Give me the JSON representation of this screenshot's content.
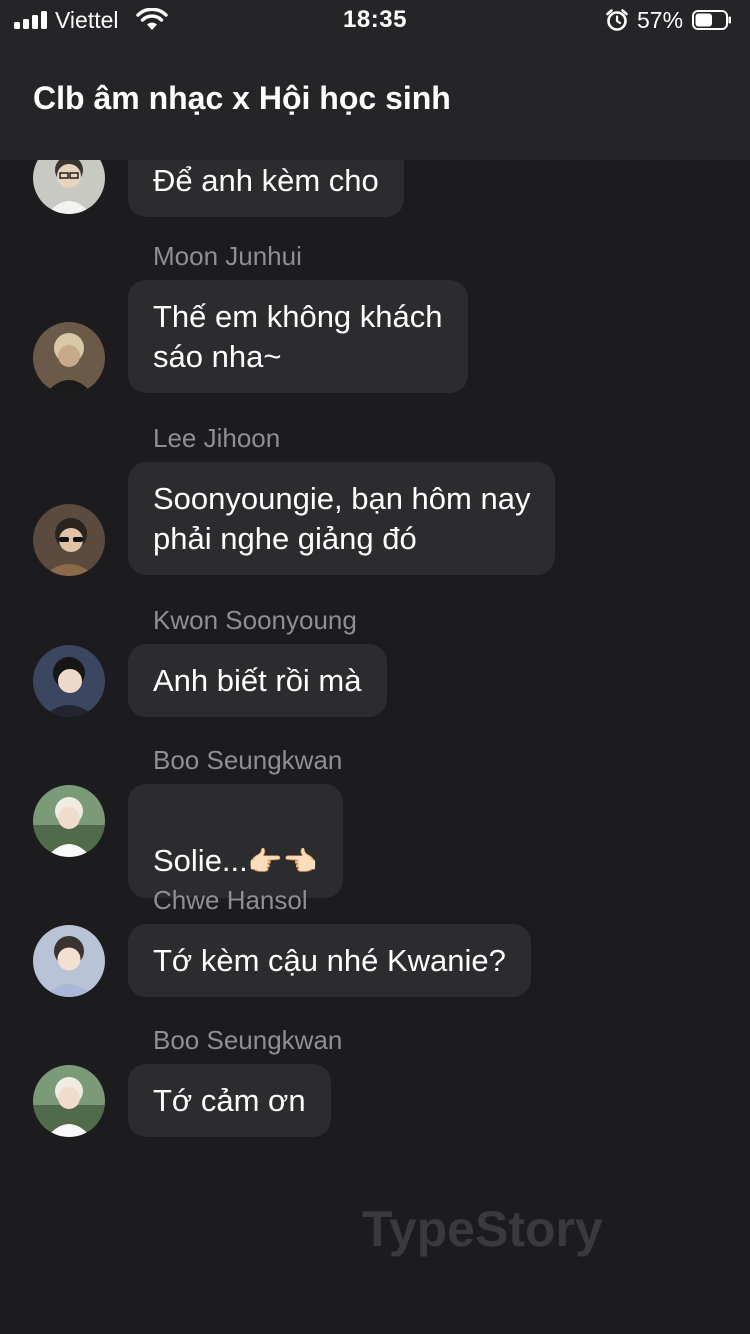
{
  "status_bar": {
    "carrier": "Viettel",
    "time": "18:35",
    "battery_percent": "57%",
    "battery_level": 0.57,
    "icons": [
      "signal-icon",
      "wifi-icon",
      "alarm-icon",
      "battery-icon"
    ]
  },
  "header": {
    "title": "Clb âm nhạc x Hội học sinh"
  },
  "messages": [
    {
      "sender": "",
      "text": "Để anh kèm cho",
      "avatar_color": "#c9c9c4"
    },
    {
      "sender": "Moon Junhui",
      "text": "Thế em không khách\nsáo nha~",
      "avatar_color": "#6b5a48"
    },
    {
      "sender": "Lee Jihoon",
      "text": "Soonyoungie, bạn hôm nay\nphải nghe giảng đó",
      "avatar_color": "#5b4a3e"
    },
    {
      "sender": "Kwon Soonyoung",
      "text": "Anh biết rồi mà",
      "avatar_color": "#3b4660"
    },
    {
      "sender": "Boo Seungkwan",
      "text": "Solie...",
      "emoji": "👉🏻👈🏻",
      "avatar_color": "#7a9a78"
    },
    {
      "sender": "Chwe Hansol",
      "text": "Tớ kèm cậu nhé Kwanie?",
      "avatar_color": "#b9c3d6"
    },
    {
      "sender": "Boo Seungkwan",
      "text": "Tớ cảm ơn",
      "avatar_color": "#7a9a78"
    }
  ],
  "watermark": "TypeStory",
  "colors": {
    "background": "#1c1c1e",
    "bubble": "#2c2c2e",
    "sender_name": "#8e8e93",
    "header": "#252527"
  }
}
